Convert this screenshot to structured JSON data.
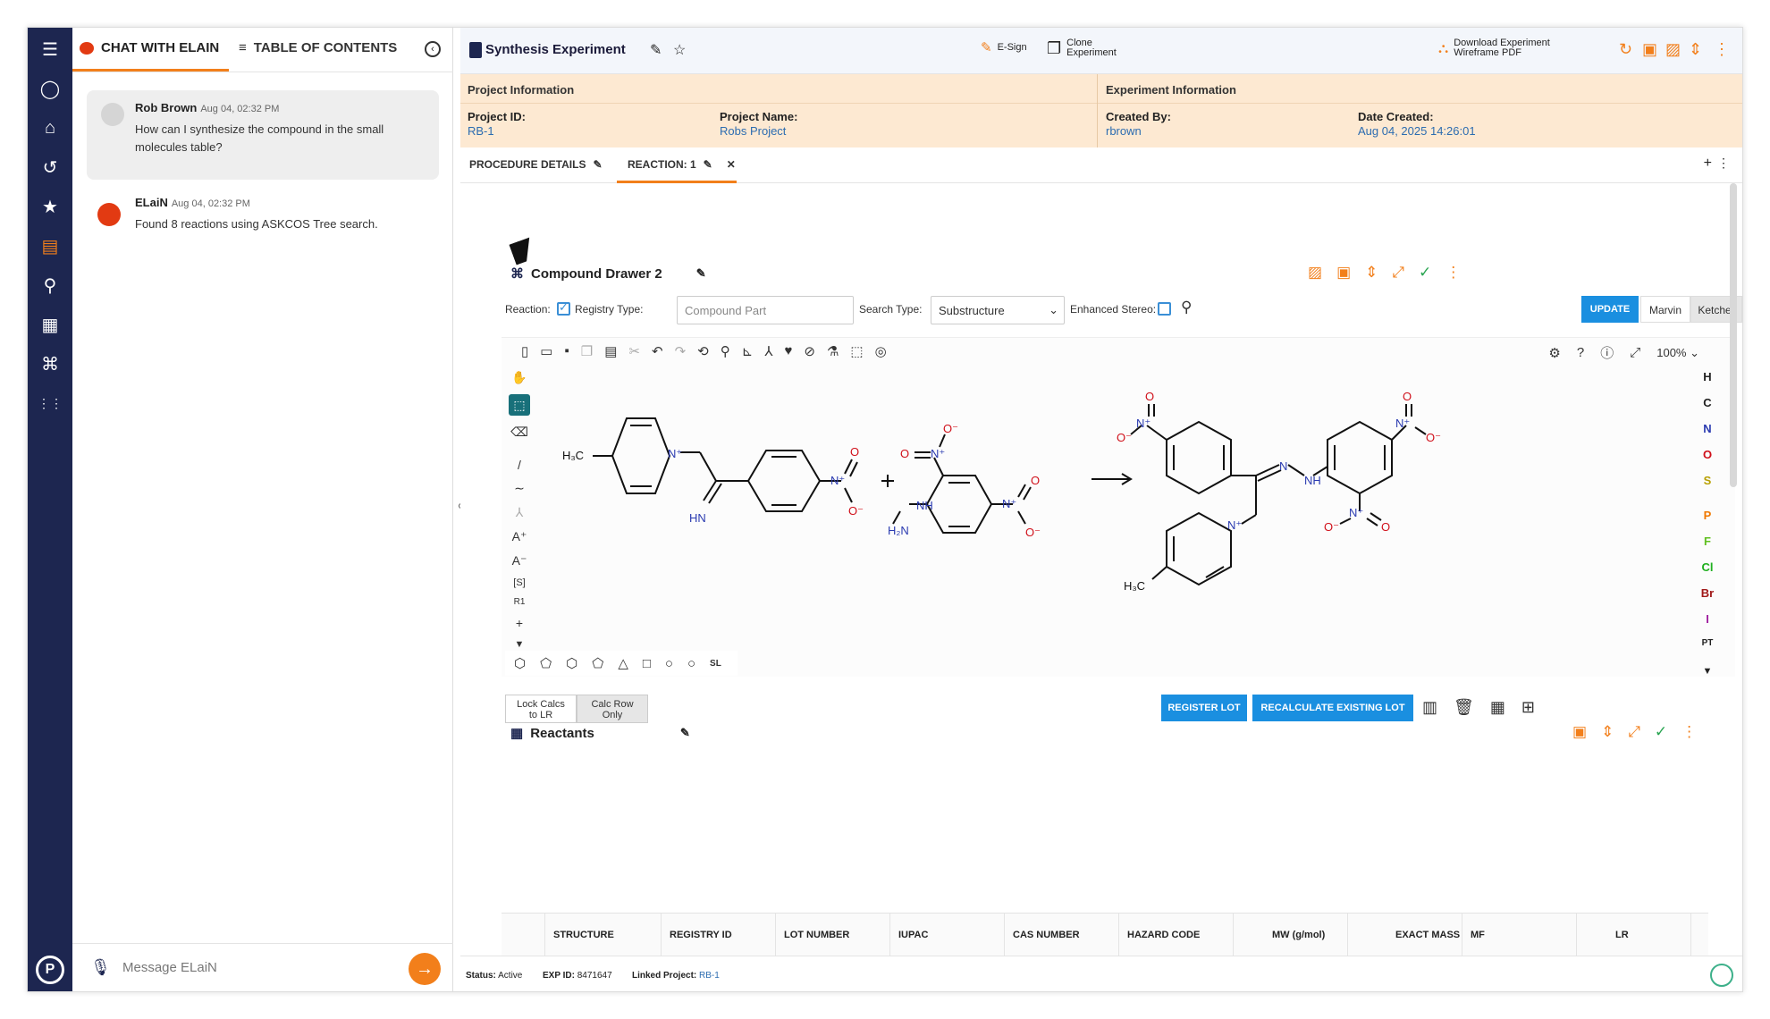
{
  "rail": {
    "icons": [
      "menu-icon",
      "user-icon",
      "home-icon",
      "history-icon",
      "star-icon",
      "chat-icon",
      "search-icon",
      "book-search-icon",
      "molecule-icon",
      "grid-icon"
    ]
  },
  "chat": {
    "tab_chat": "CHAT WITH ELAIN",
    "tab_toc": "TABLE OF CONTENTS",
    "messages": [
      {
        "name": "Rob Brown",
        "time": "Aug 04, 02:32 PM",
        "text": "How can I synthesize the compound in the small molecules table?"
      },
      {
        "name": "ELaiN",
        "time": "Aug 04, 02:32 PM",
        "text": "Found 8 reactions using ASKCOS Tree search."
      }
    ],
    "input_placeholder": "Message ELaiN"
  },
  "header": {
    "title": "Synthesis Experiment",
    "esign": "E-Sign",
    "clone_line1": "Clone",
    "clone_line2": "Experiment",
    "download_line1": "Download Experiment",
    "download_line2": "Wireframe PDF"
  },
  "info": {
    "project_heading": "Project Information",
    "experiment_heading": "Experiment Information",
    "project_id_label": "Project ID:",
    "project_id": "RB-1",
    "project_name_label": "Project Name:",
    "project_name": "Robs Project",
    "created_by_label": "Created By:",
    "created_by": "rbrown",
    "date_created_label": "Date Created:",
    "date_created": "Aug 04, 2025 14:26:01"
  },
  "tabs": {
    "procedure": "PROCEDURE DETAILS",
    "reaction": "REACTION: 1"
  },
  "drawer": {
    "title": "Compound Drawer 2",
    "reaction_label": "Reaction:",
    "registry_type_label": "Registry Type:",
    "compound_part_placeholder": "Compound Part",
    "search_type_label": "Search Type:",
    "search_type_value": "Substructure",
    "enhanced_stereo_label": "Enhanced Stereo:",
    "update": "UPDATE",
    "marvin": "Marvin",
    "ketcher": "Ketcher",
    "zoom": "100%",
    "elements": [
      "H",
      "C",
      "N",
      "O",
      "S",
      "P",
      "F",
      "Cl",
      "Br",
      "I",
      "PT"
    ],
    "element_colors": {
      "H": "#222222",
      "C": "#222222",
      "N": "#2a3ab0",
      "O": "#d0101a",
      "S": "#b8a000",
      "P": "#f07800",
      "F": "#60c020",
      "Cl": "#20b020",
      "Br": "#a01818",
      "I": "#a020a0",
      "PT": "#222222"
    }
  },
  "reactants": {
    "title": "Reactants",
    "lock_calcs_1": "Lock Calcs",
    "lock_calcs_2": "to LR",
    "calc_row_1": "Calc Row",
    "calc_row_2": "Only",
    "register_lot": "REGISTER LOT",
    "recalculate": "RECALCULATE EXISTING LOT",
    "columns": [
      "STRUCTURE",
      "REGISTRY ID",
      "LOT NUMBER",
      "IUPAC",
      "CAS NUMBER",
      "HAZARD CODE",
      "MW (g/mol)",
      "EXACT MASS",
      "MF",
      "LR"
    ]
  },
  "status": {
    "status_label": "Status:",
    "status_value": "Active",
    "exp_id_label": "EXP ID:",
    "exp_id": "8471647",
    "linked_label": "Linked Project:",
    "linked_value": "RB-1"
  },
  "colors": {
    "accent": "#f27f1b",
    "rail": "#1d2650",
    "primary_button": "#1a8fe0",
    "info_band": "#fde9d2"
  }
}
